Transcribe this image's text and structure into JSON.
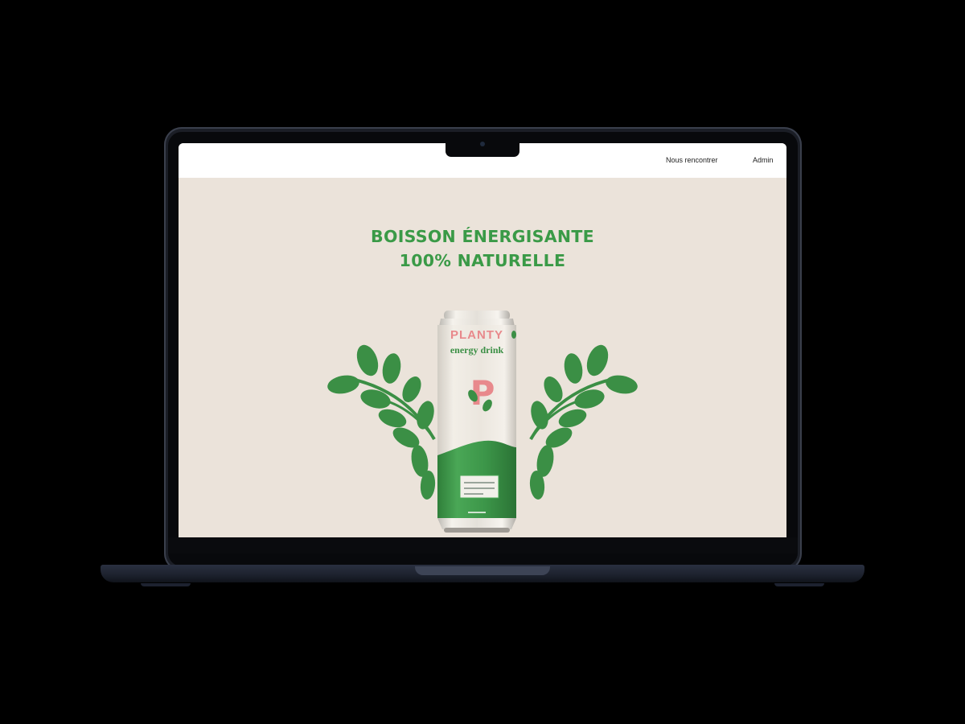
{
  "nav": {
    "links": [
      "Nous rencontrer",
      "Admin"
    ]
  },
  "hero": {
    "headline_line1": "BOISSON ÉNERGISANTE",
    "headline_line2": "100% NATURELLE"
  },
  "product": {
    "brand": "PLANTY",
    "subtitle": "energy drink",
    "logo_letter": "P"
  },
  "colors": {
    "brand_green": "#3a9a47",
    "leaf_green": "#3b8f45",
    "brand_pink": "#e8898c",
    "page_background": "#ebe3da",
    "nav_background": "#ffffff",
    "laptop_body": "#1b1e26"
  }
}
